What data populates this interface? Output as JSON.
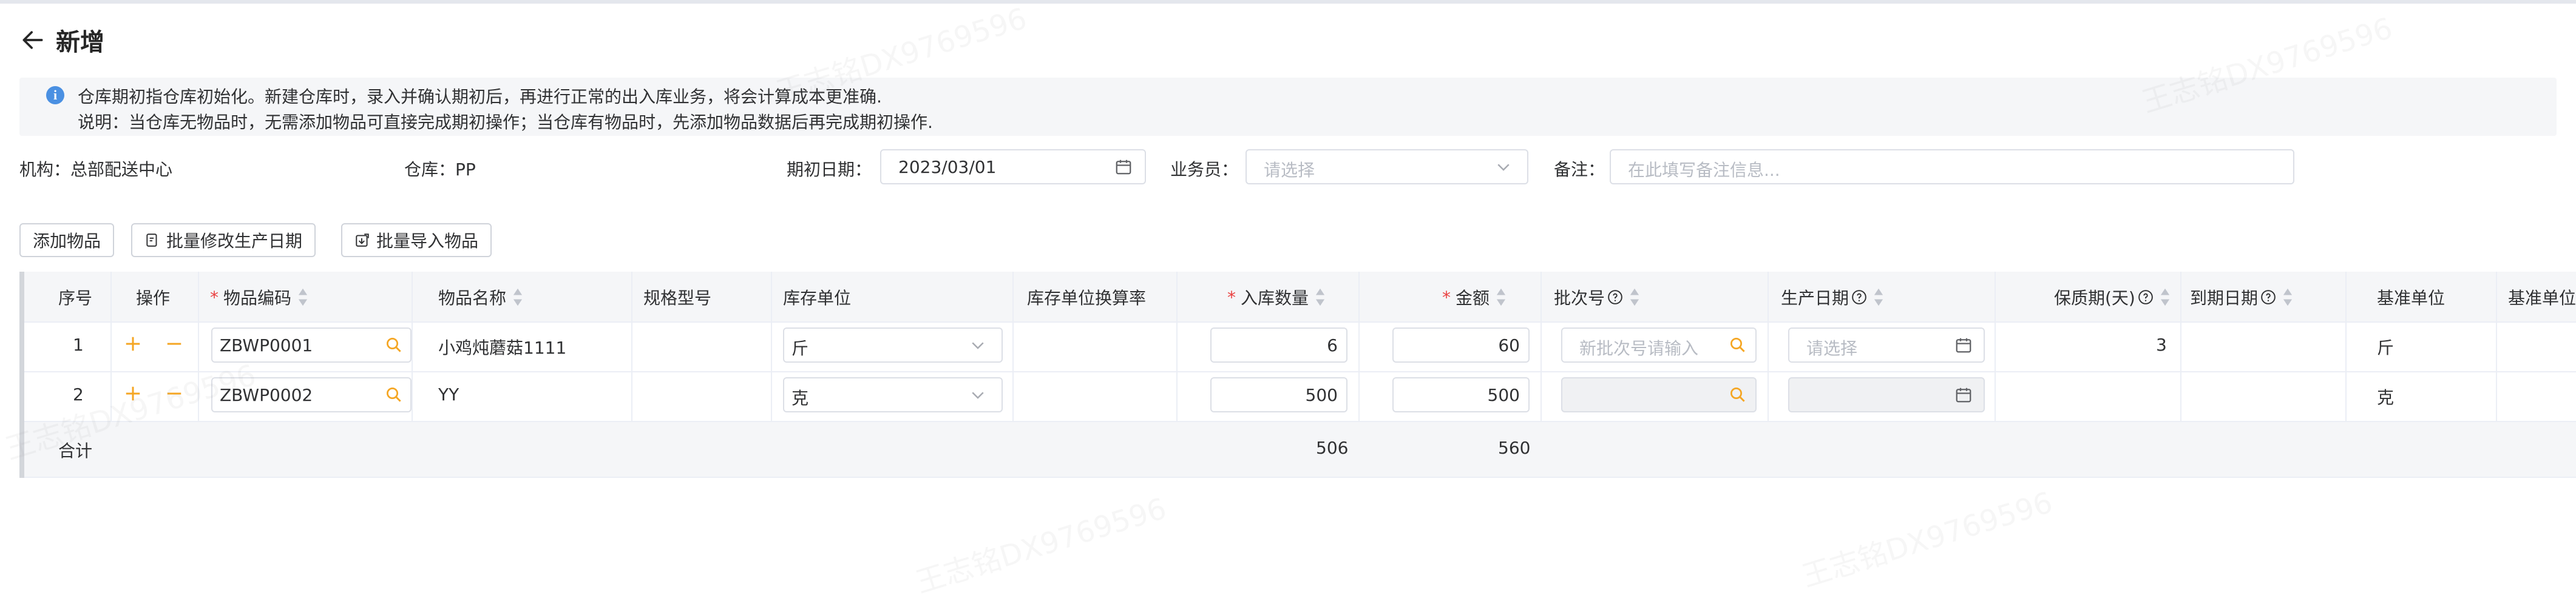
{
  "page": {
    "title": "新增"
  },
  "notice": {
    "line1": "仓库期初指仓库初始化。新建仓库时，录入并确认期初后，再进行正常的出入库业务，将会计算成本更准确.",
    "line2": "说明：当仓库无物品时，无需添加物品可直接完成期初操作；当仓库有物品时，先添加物品数据后再完成期初操作."
  },
  "form": {
    "org_label": "机构：",
    "org_value": "总部配送中心",
    "warehouse_label": "仓库：",
    "warehouse_value": "PP",
    "date_label": "期初日期：",
    "date_value": "2023/03/01",
    "staff_label": "业务员：",
    "staff_placeholder": "请选择",
    "remark_label": "备注：",
    "remark_placeholder": "在此填写备注信息..."
  },
  "toolbar": {
    "add_item": "添加物品",
    "batch_edit_date": "批量修改生产日期",
    "batch_import": "批量导入物品"
  },
  "table": {
    "headers": {
      "seq": "序号",
      "op": "操作",
      "code": "物品编码",
      "name": "物品名称",
      "spec": "规格型号",
      "unit": "库存单位",
      "rate": "库存单位换算率",
      "qty": "入库数量",
      "amount": "金额",
      "batch": "批次号",
      "prod_date": "生产日期",
      "shelf": "保质期(天)",
      "expire": "到期日期",
      "base_unit": "基准单位",
      "base_unit2": "基准单位"
    },
    "rows": [
      {
        "seq": "1",
        "code": "ZBWP0001",
        "name": "小鸡炖蘑菇1111",
        "unit": "斤",
        "qty": "6",
        "amount": "60",
        "batch_placeholder": "新批次号请输入",
        "date_placeholder": "请选择",
        "shelf": "3",
        "base_unit": "斤"
      },
      {
        "seq": "2",
        "code": "ZBWP0002",
        "name": "YY",
        "unit": "克",
        "qty": "500",
        "amount": "500",
        "batch_placeholder": "",
        "date_placeholder": "",
        "shelf": "",
        "base_unit": "克"
      }
    ],
    "summary": {
      "label": "合计",
      "qty": "506",
      "amount": "560"
    }
  },
  "watermark": "王志铭DX9769596",
  "colors": {
    "accent": "#f5a623",
    "required": "#e94141",
    "info": "#4a90e2"
  },
  "icons": [
    "back-arrow-icon",
    "info-icon",
    "calendar-icon",
    "chevron-down-icon",
    "search-icon",
    "plus-icon",
    "minus-icon",
    "sort-icon",
    "question-icon",
    "edit-doc-icon",
    "import-icon"
  ]
}
